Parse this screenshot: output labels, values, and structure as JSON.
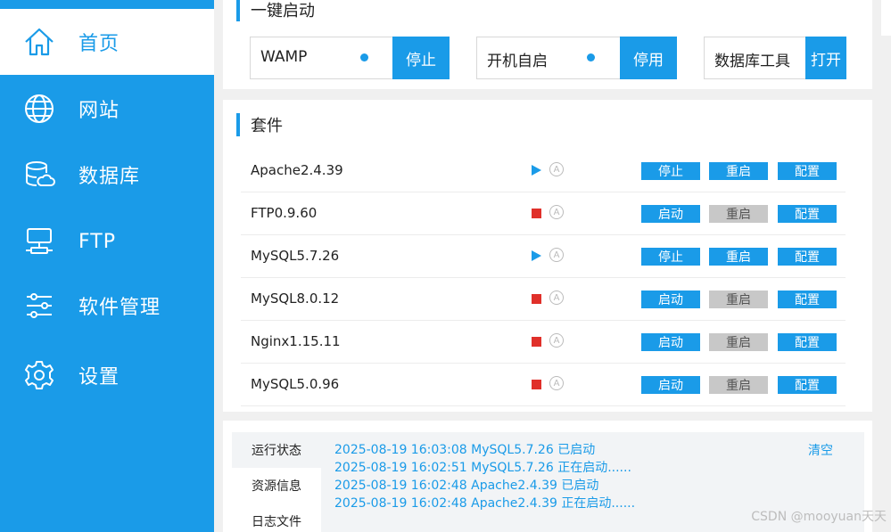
{
  "sidebar": {
    "items": [
      {
        "label": "首页",
        "icon": "home-icon",
        "active": true
      },
      {
        "label": "网站",
        "icon": "globe-icon"
      },
      {
        "label": "数据库",
        "icon": "database-icon"
      },
      {
        "label": "FTP",
        "icon": "server-icon"
      },
      {
        "label": "软件管理",
        "icon": "sliders-icon"
      },
      {
        "label": "设置",
        "icon": "gear-icon"
      }
    ]
  },
  "quick_start": {
    "title": "一键启动",
    "items": [
      {
        "label": "WAMP",
        "button": "停止"
      },
      {
        "label": "开机自启",
        "button": "停用"
      },
      {
        "label": "数据库工具",
        "button": "打开"
      }
    ]
  },
  "suite": {
    "title": "套件",
    "auto_glyph": "A",
    "rows": [
      {
        "name": "Apache2.4.39",
        "status": "running",
        "action": "停止",
        "restart": "重启",
        "config": "配置"
      },
      {
        "name": "FTP0.9.60",
        "status": "stopped",
        "action": "启动",
        "restart": "重启",
        "config": "配置"
      },
      {
        "name": "MySQL5.7.26",
        "status": "running",
        "action": "停止",
        "restart": "重启",
        "config": "配置"
      },
      {
        "name": "MySQL8.0.12",
        "status": "stopped",
        "action": "启动",
        "restart": "重启",
        "config": "配置"
      },
      {
        "name": "Nginx1.15.11",
        "status": "stopped",
        "action": "启动",
        "restart": "重启",
        "config": "配置"
      },
      {
        "name": "MySQL5.0.96",
        "status": "stopped",
        "action": "启动",
        "restart": "重启",
        "config": "配置"
      }
    ]
  },
  "log": {
    "tabs": [
      "运行状态",
      "资源信息",
      "日志文件"
    ],
    "clear_label": "清空",
    "lines": [
      "2025-08-19 16:03:08 MySQL5.7.26 已启动",
      "2025-08-19 16:02:51 MySQL5.7.26 正在启动......",
      "2025-08-19 16:02:48 Apache2.4.39 已启动",
      "2025-08-19 16:02:48 Apache2.4.39 正在启动......"
    ]
  },
  "watermark": "CSDN @mooyuan天天",
  "colors": {
    "accent": "#1a9be8",
    "stopped": "#e0302a",
    "disabled": "#c8c8c8"
  }
}
